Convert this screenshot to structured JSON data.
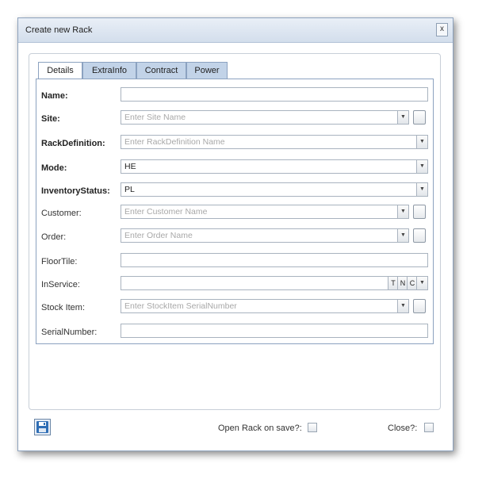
{
  "dialog": {
    "title": "Create new Rack",
    "close_label": "x"
  },
  "tabs": [
    {
      "label": "Details"
    },
    {
      "label": "ExtraInfo"
    },
    {
      "label": "Contract"
    },
    {
      "label": "Power"
    }
  ],
  "form": {
    "name": {
      "label": "Name:",
      "value": ""
    },
    "site": {
      "label": "Site:",
      "placeholder": "Enter Site Name"
    },
    "rack_definition": {
      "label": "RackDefinition:",
      "placeholder": "Enter RackDefinition Name"
    },
    "mode": {
      "label": "Mode:",
      "value": "HE"
    },
    "inventory_status": {
      "label": "InventoryStatus:",
      "value": "PL"
    },
    "customer": {
      "label": "Customer:",
      "placeholder": "Enter Customer Name"
    },
    "order": {
      "label": "Order:",
      "placeholder": "Enter Order Name"
    },
    "floor_tile": {
      "label": "FloorTile:",
      "value": ""
    },
    "in_service": {
      "label": "InService:",
      "value": "",
      "buttons": [
        "T",
        "N",
        "C"
      ]
    },
    "stock_item": {
      "label": "Stock Item:",
      "placeholder": "Enter StockItem SerialNumber"
    },
    "serial_number": {
      "label": "SerialNumber:",
      "value": ""
    }
  },
  "footer": {
    "open_rack_label": "Open Rack on save?:",
    "open_rack_checked": false,
    "close_label": "Close?:",
    "close_checked": false
  },
  "colors": {
    "accent": "#2f6eb5",
    "tab_bg": "#c2d3e8",
    "border": "#8ca2c0"
  }
}
